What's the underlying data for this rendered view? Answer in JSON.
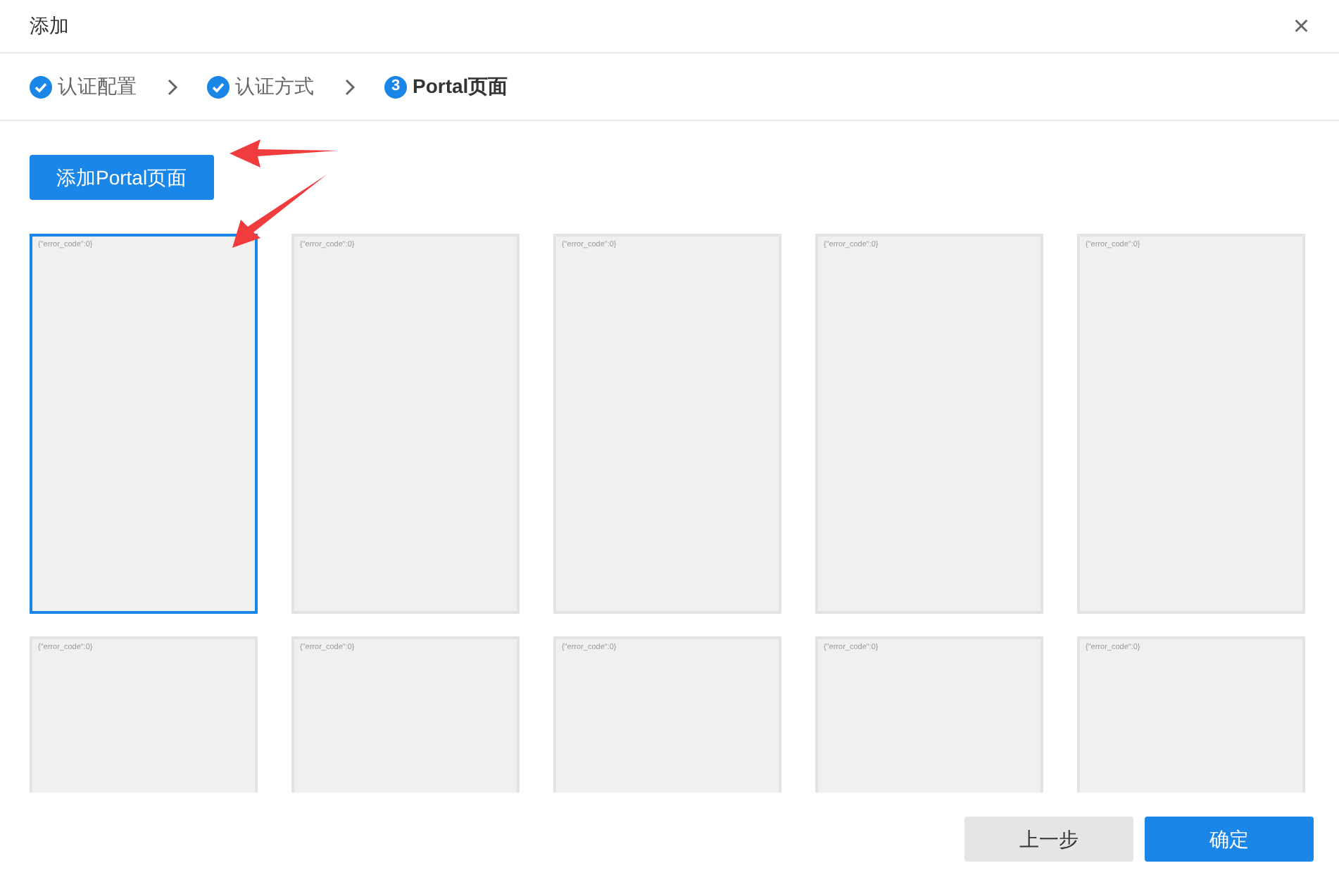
{
  "window": {
    "title": "添加",
    "close": "×"
  },
  "steps": [
    {
      "label": "认证配置",
      "completed": true
    },
    {
      "label": "认证方式",
      "completed": true
    },
    {
      "label": "Portal页面",
      "completed": false,
      "number": "3"
    }
  ],
  "add_button": "添加Portal页面",
  "pages": [
    {
      "text": "{\"error_code\":0}",
      "selected": true
    },
    {
      "text": "{\"error_code\":0}",
      "selected": false
    },
    {
      "text": "{\"error_code\":0}",
      "selected": false
    },
    {
      "text": "{\"error_code\":0}",
      "selected": false
    },
    {
      "text": "{\"error_code\":0}",
      "selected": false
    },
    {
      "text": "{\"error_code\":0}",
      "selected": false
    },
    {
      "text": "{\"error_code\":0}",
      "selected": false
    },
    {
      "text": "{\"error_code\":0}",
      "selected": false
    },
    {
      "text": "{\"error_code\":0}",
      "selected": false
    },
    {
      "text": "{\"error_code\":0}",
      "selected": false
    }
  ],
  "annotations": [
    {
      "kind": "arrow-left"
    },
    {
      "kind": "arrow-down-left"
    }
  ],
  "buttons": [
    {
      "label": "上一步",
      "kind": "secondary"
    },
    {
      "label": "确定",
      "kind": "primary"
    }
  ]
}
